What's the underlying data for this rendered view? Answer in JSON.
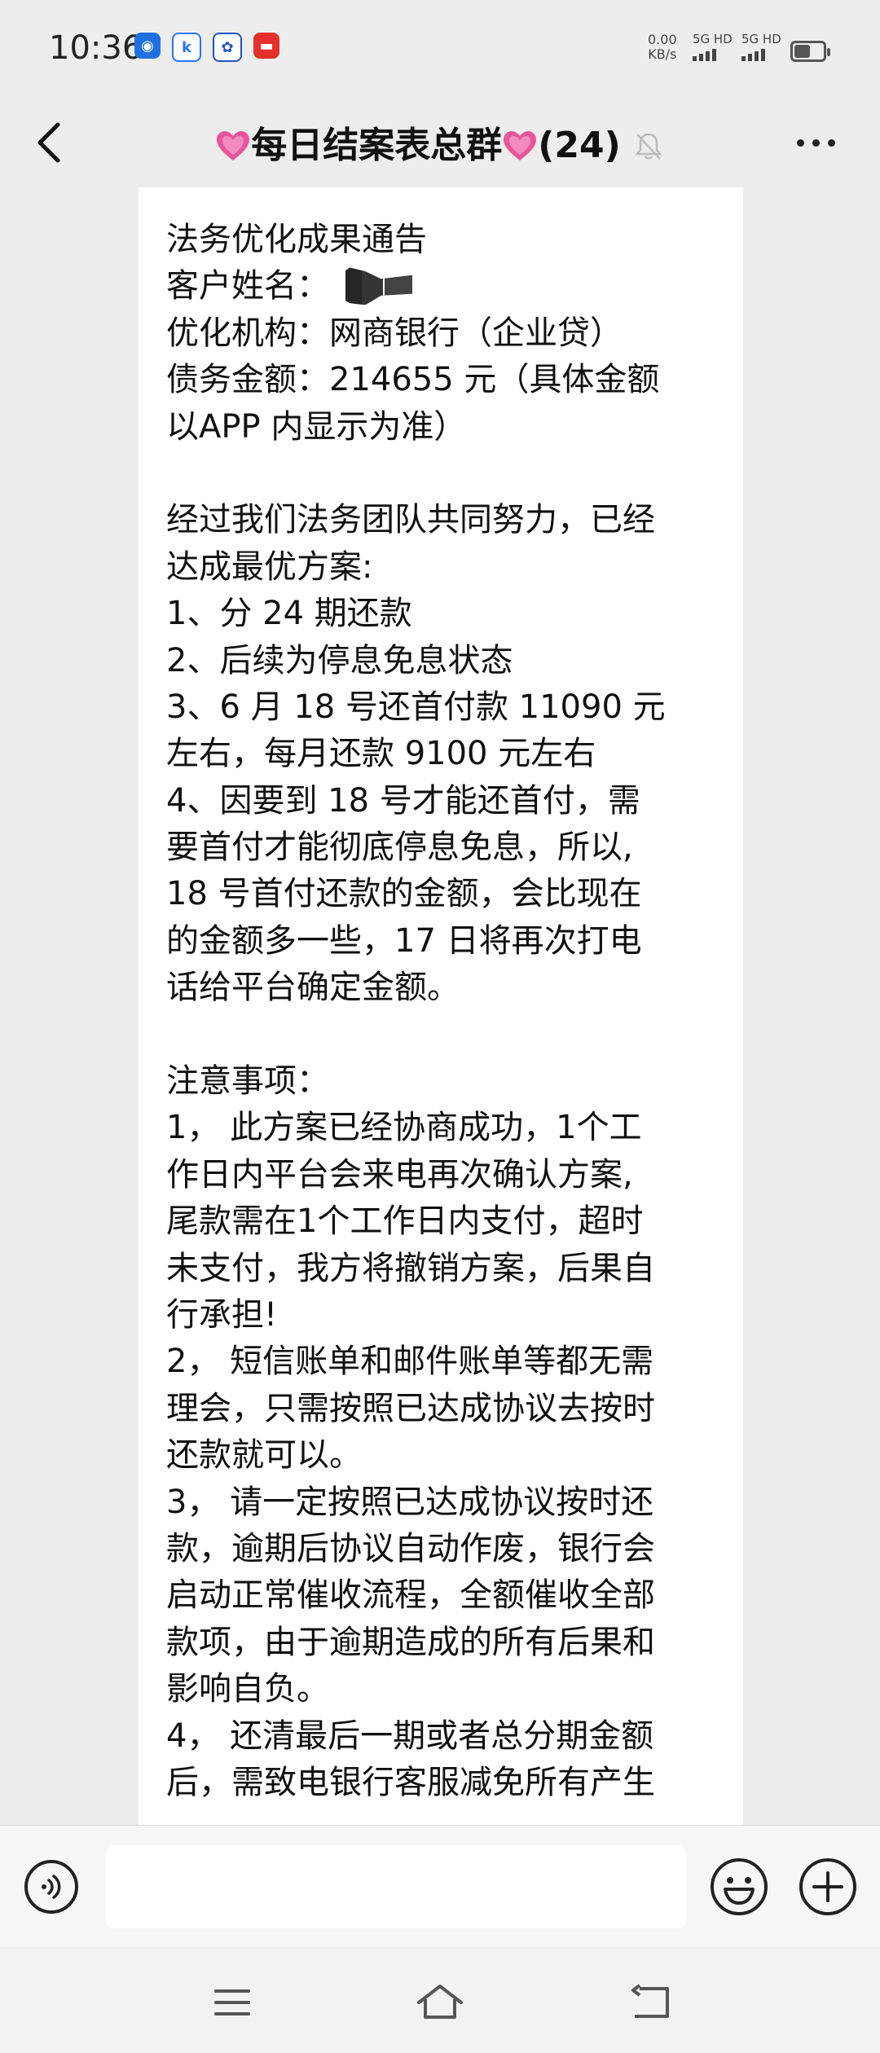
{
  "status_bar": {
    "time": "10:36",
    "network_speed_value": "0.00",
    "network_speed_unit": "KB/s",
    "signal1": "5G HD",
    "signal2": "5G HD",
    "battery_level": 0.55,
    "notification_icons": [
      "bank-app-icon",
      "k-app-icon",
      "baidu-app-icon",
      "red-app-icon"
    ]
  },
  "chat_header": {
    "title": "每日结案表总群",
    "member_count": "(24)",
    "accent_color": "#e8559a"
  },
  "message": {
    "lines": [
      "法务优化成果通告",
      "客户姓名：",
      "优化机构：网商银行（企业贷）",
      "债务金额：214655 元（具体金额",
      "以APP 内显示为准）",
      "",
      "经过我们法务团队共同努力，已经",
      "达成最优方案:",
      "1、分 24 期还款",
      "2、后续为停息免息状态",
      "3、6 月 18 号还首付款 11090 元",
      "左右，每月还款 9100 元左右",
      "4、因要到 18 号才能还首付，需",
      "要首付才能彻底停息免息，所以,",
      "18 号首付还款的金额，会比现在",
      "的金额多一些，17 日将再次打电",
      "话给平台确定金额。",
      "",
      "注意事项：",
      "1，  此方案已经协商成功，1个工",
      "作日内平台会来电再次确认方案,",
      "尾款需在1个工作日内支付，超时",
      "未支付，我方将撤销方案，后果自",
      "行承担!",
      "2，  短信账单和邮件账单等都无需",
      "理会，只需按照已达成协议去按时",
      "还款就可以。",
      "3，  请一定按照已达成协议按时还",
      "款，逾期后协议自动作废，银行会",
      "启动正常催收流程，全额催收全部",
      "款项，由于逾期造成的所有后果和",
      "影响自负。",
      "4，  还清最后一期或者总分期金额",
      "后，需致电银行客服减免所有产生"
    ]
  },
  "input_bar": {
    "placeholder": ""
  }
}
